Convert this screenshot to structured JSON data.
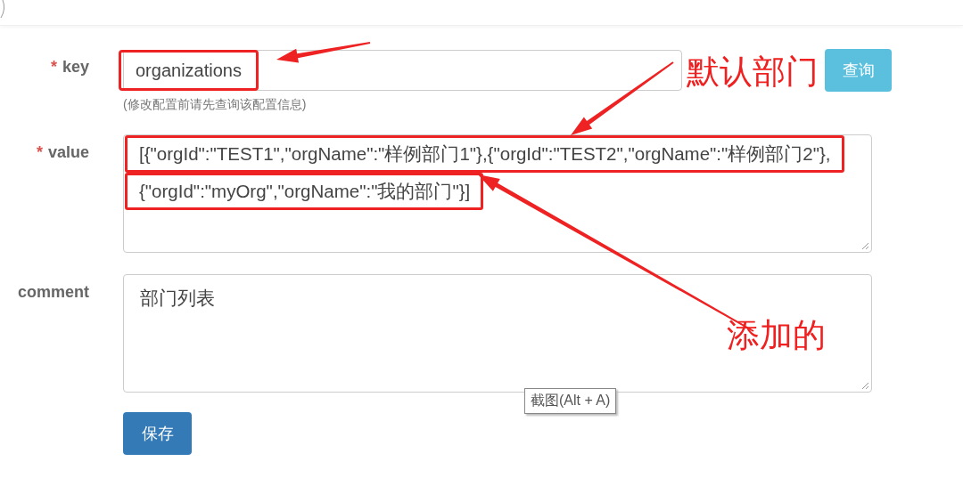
{
  "fields": [
    {
      "kind": "input",
      "required_mark": "*",
      "label": "key",
      "value": "organizations",
      "value_highlighted": true,
      "button": {
        "label": "查询"
      },
      "hint": "(修改配置前请先查询该配置信息)"
    },
    {
      "kind": "textarea",
      "required_mark": "*",
      "label": "value",
      "lines": [
        {
          "text": "[{\"orgId\":\"TEST1\",\"orgName\":\"样例部门1\"},{\"orgId\":\"TEST2\",\"orgName\":\"样例部门2\"},",
          "highlighted": true
        },
        {
          "text": "{\"orgId\":\"myOrg\",\"orgName\":\"我的部门\"}]",
          "highlighted": true
        }
      ]
    },
    {
      "kind": "textarea",
      "label": "comment",
      "lines": [
        {
          "text": "部门列表",
          "highlighted": false
        }
      ]
    }
  ],
  "save_button": {
    "label": "保存"
  },
  "tooltip": {
    "text": "截图(Alt + A)"
  },
  "annotations": [
    {
      "text": "默认部门"
    },
    {
      "text": "添加的"
    }
  ]
}
